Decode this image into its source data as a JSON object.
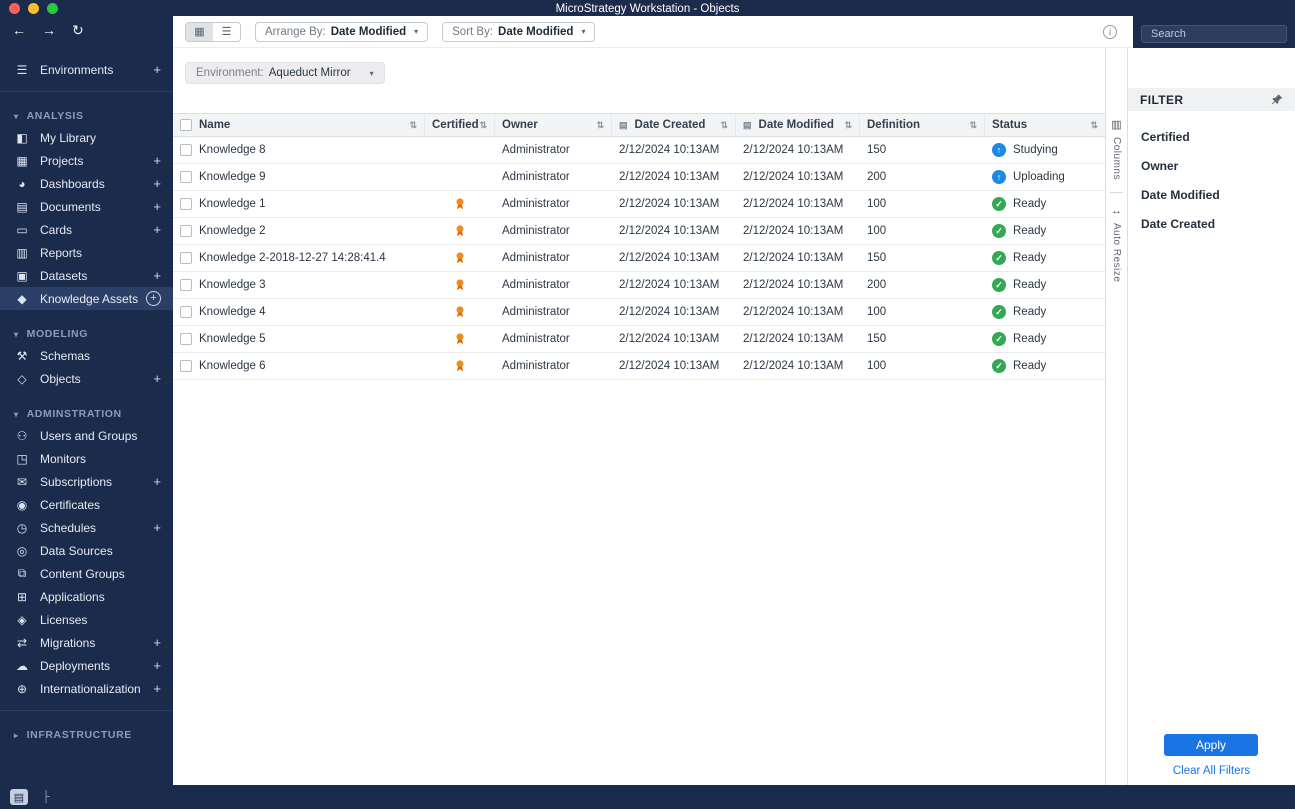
{
  "window": {
    "title": "MicroStrategy Workstation - Objects"
  },
  "colors": {
    "accent_blue": "#1b74e4",
    "sidebar_bg": "#1b2b4b",
    "status_ready_green": "#34a853",
    "status_progress_blue": "#1e88e5",
    "certified_orange": "#ef8b1f"
  },
  "icons": {
    "add": "+",
    "sort": "⇅",
    "back_arrow": "←",
    "forward_arrow": "→",
    "refresh": "↻",
    "grid_view": "▦",
    "list_view": "☰",
    "info": "i",
    "dropdown_chevron": "▾",
    "calendar": "▤",
    "columns": "▥",
    "auto_resize": "↔",
    "detail_view": "▤",
    "tree_view": "├"
  },
  "toolbar": {
    "arrange_by_label": "Arrange By:",
    "arrange_by_value": "Date Modified",
    "sort_by_label": "Sort By:",
    "sort_by_value": "Date Modified",
    "search_placeholder": "Search"
  },
  "environment": {
    "label": "Environment:",
    "value": "Aqueduct Mirror"
  },
  "sidebar": {
    "rows": [
      {
        "type": "item",
        "name": "sidebar-item-environments",
        "label": "Environments",
        "icon": "environments-icon",
        "glyph": "☰",
        "plus": true
      },
      {
        "type": "divider",
        "name": "sidebar-divider"
      },
      {
        "type": "section",
        "name": "sidebar-section-analysis",
        "label": "ANALYSIS",
        "chevron": "▾"
      },
      {
        "type": "item",
        "name": "sidebar-item-my-library",
        "label": "My Library",
        "icon": "my-library-icon",
        "glyph": "◧"
      },
      {
        "type": "item",
        "name": "sidebar-item-projects",
        "label": "Projects",
        "icon": "projects-icon",
        "glyph": "▦",
        "plus": true
      },
      {
        "type": "item",
        "name": "sidebar-item-dashboards",
        "label": "Dashboards",
        "icon": "dashboards-icon",
        "glyph": "◕",
        "plus": true
      },
      {
        "type": "item",
        "name": "sidebar-item-documents",
        "label": "Documents",
        "icon": "documents-icon",
        "glyph": "▤",
        "plus": true
      },
      {
        "type": "item",
        "name": "sidebar-item-cards",
        "label": "Cards",
        "icon": "cards-icon",
        "glyph": "▭",
        "plus": true
      },
      {
        "type": "item",
        "name": "sidebar-item-reports",
        "label": "Reports",
        "icon": "reports-icon",
        "glyph": "▥"
      },
      {
        "type": "item",
        "name": "sidebar-item-datasets",
        "label": "Datasets",
        "icon": "datasets-icon",
        "glyph": "▣",
        "plus": true
      },
      {
        "type": "item",
        "name": "sidebar-item-knowledge-assets",
        "label": "Knowledge Assets",
        "icon": "knowledge-assets-icon",
        "glyph": "◆",
        "plus": true,
        "selected": true,
        "plus_circled": true
      },
      {
        "type": "section",
        "name": "sidebar-section-modeling",
        "label": "MODELING",
        "chevron": "▾"
      },
      {
        "type": "item",
        "name": "sidebar-item-schemas",
        "label": "Schemas",
        "icon": "schemas-icon",
        "glyph": "⚒"
      },
      {
        "type": "item",
        "name": "sidebar-item-objects",
        "label": "Objects",
        "icon": "objects-icon",
        "glyph": "◇",
        "plus": true
      },
      {
        "type": "section",
        "name": "sidebar-section-administration",
        "label": "ADMINSTRATION",
        "chevron": "▾"
      },
      {
        "type": "item",
        "name": "sidebar-item-users-and-groups",
        "label": "Users and Groups",
        "icon": "users-groups-icon",
        "glyph": "⚇"
      },
      {
        "type": "item",
        "name": "sidebar-item-monitors",
        "label": "Monitors",
        "icon": "monitors-icon",
        "glyph": "◳"
      },
      {
        "type": "item",
        "name": "sidebar-item-subscriptions",
        "label": "Subscriptions",
        "icon": "subscriptions-icon",
        "glyph": "✉",
        "plus": true
      },
      {
        "type": "item",
        "name": "sidebar-item-certificates",
        "label": "Certificates",
        "icon": "certificates-icon",
        "glyph": "◉"
      },
      {
        "type": "item",
        "name": "sidebar-item-schedules",
        "label": "Schedules",
        "icon": "schedules-icon",
        "glyph": "◷",
        "plus": true
      },
      {
        "type": "item",
        "name": "sidebar-item-data-sources",
        "label": "Data Sources",
        "icon": "data-sources-icon",
        "glyph": "◎"
      },
      {
        "type": "item",
        "name": "sidebar-item-content-groups",
        "label": "Content Groups",
        "icon": "content-groups-icon",
        "glyph": "⧉"
      },
      {
        "type": "item",
        "name": "sidebar-item-applications",
        "label": "Applications",
        "icon": "applications-icon",
        "glyph": "⊞"
      },
      {
        "type": "item",
        "name": "sidebar-item-licenses",
        "label": "Licenses",
        "icon": "licenses-icon",
        "glyph": "◈"
      },
      {
        "type": "item",
        "name": "sidebar-item-migrations",
        "label": "Migrations",
        "icon": "migrations-icon",
        "glyph": "⇄",
        "plus": true
      },
      {
        "type": "item",
        "name": "sidebar-item-deployments",
        "label": "Deployments",
        "icon": "deployments-icon",
        "glyph": "☁",
        "plus": true
      },
      {
        "type": "item",
        "name": "sidebar-item-internationalization",
        "label": "Internationalization",
        "icon": "internationalization-icon",
        "glyph": "⊕",
        "plus": true
      },
      {
        "type": "divider",
        "name": "sidebar-divider"
      },
      {
        "type": "section",
        "name": "sidebar-section-infrastructure",
        "label": "INFRASTRUCTURE",
        "chevron": "▸"
      }
    ]
  },
  "table": {
    "columns": [
      {
        "label": "Name"
      },
      {
        "label": "Certified"
      },
      {
        "label": "Owner"
      },
      {
        "label": "Date Created"
      },
      {
        "label": "Date Modified"
      },
      {
        "label": "Definition"
      },
      {
        "label": "Status"
      }
    ],
    "rows": [
      {
        "name": "Knowledge 8",
        "certified": false,
        "owner": "Administrator",
        "date_created": "2/12/2024 10:13AM",
        "date_modified": "2/12/2024 10:13AM",
        "definition": "150",
        "status": "Studying",
        "status_type": "progress"
      },
      {
        "name": "Knowledge 9",
        "certified": false,
        "owner": "Administrator",
        "date_created": "2/12/2024 10:13AM",
        "date_modified": "2/12/2024 10:13AM",
        "definition": "200",
        "status": "Uploading",
        "status_type": "progress"
      },
      {
        "name": "Knowledge 1",
        "certified": true,
        "owner": "Administrator",
        "date_created": "2/12/2024 10:13AM",
        "date_modified": "2/12/2024 10:13AM",
        "definition": "100",
        "status": "Ready",
        "status_type": "ready"
      },
      {
        "name": "Knowledge 2",
        "certified": true,
        "owner": "Administrator",
        "date_created": "2/12/2024 10:13AM",
        "date_modified": "2/12/2024 10:13AM",
        "definition": "100",
        "status": "Ready",
        "status_type": "ready"
      },
      {
        "name": "Knowledge 2-2018-12-27 14:28:41.4",
        "certified": true,
        "owner": "Administrator",
        "date_created": "2/12/2024 10:13AM",
        "date_modified": "2/12/2024 10:13AM",
        "definition": "150",
        "status": "Ready",
        "status_type": "ready"
      },
      {
        "name": "Knowledge 3",
        "certified": true,
        "owner": "Administrator",
        "date_created": "2/12/2024 10:13AM",
        "date_modified": "2/12/2024 10:13AM",
        "definition": "200",
        "status": "Ready",
        "status_type": "ready"
      },
      {
        "name": "Knowledge 4",
        "certified": true,
        "owner": "Administrator",
        "date_created": "2/12/2024 10:13AM",
        "date_modified": "2/12/2024 10:13AM",
        "definition": "100",
        "status": "Ready",
        "status_type": "ready"
      },
      {
        "name": "Knowledge 5",
        "certified": true,
        "owner": "Administrator",
        "date_created": "2/12/2024 10:13AM",
        "date_modified": "2/12/2024 10:13AM",
        "definition": "150",
        "status": "Ready",
        "status_type": "ready"
      },
      {
        "name": "Knowledge 6",
        "certified": true,
        "owner": "Administrator",
        "date_created": "2/12/2024 10:13AM",
        "date_modified": "2/12/2024 10:13AM",
        "definition": "100",
        "status": "Ready",
        "status_type": "ready"
      }
    ]
  },
  "side_strip": {
    "columns_label": "Columns",
    "auto_resize_label": "Auto Resize"
  },
  "filter": {
    "title": "FILTER",
    "items": [
      {
        "label": "Certified",
        "name": "filter-item-certified"
      },
      {
        "label": "Owner",
        "name": "filter-item-owner"
      },
      {
        "label": "Date Modified",
        "name": "filter-item-date-modified"
      },
      {
        "label": "Date Created",
        "name": "filter-item-date-created"
      }
    ],
    "apply_label": "Apply",
    "clear_label": "Clear All Filters"
  }
}
